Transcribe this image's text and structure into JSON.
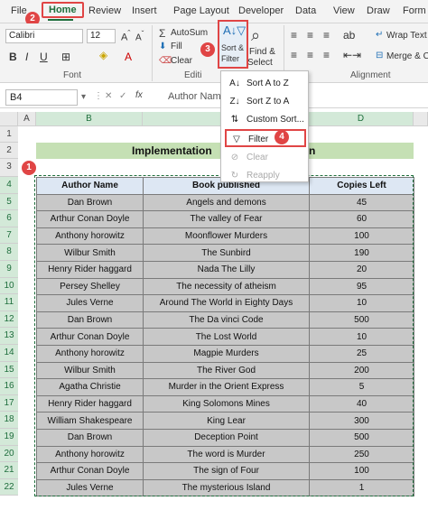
{
  "menu": {
    "tabs": [
      "File",
      "Home",
      "Review",
      "Insert",
      "Page Layout",
      "Developer",
      "Data",
      "View",
      "Draw",
      "Form"
    ]
  },
  "ribbon": {
    "font_name": "Calibri",
    "font_size": "12",
    "autosum_label": "AutoSum",
    "fill_label": "Fill",
    "clear_label": "Clear",
    "sort_filter_label_1": "Sort &",
    "sort_filter_label_2": "Filter",
    "find_select_label_1": "Find &",
    "find_select_label_2": "Select",
    "wrap_text_label": "Wrap Text",
    "merge_label": "Merge & C",
    "group_font": "Font",
    "group_editing": "Editi",
    "group_alignment": "Alignment"
  },
  "formula_bar": {
    "name_box": "B4",
    "content": "Author Nam"
  },
  "dropdown": {
    "items": [
      {
        "label": "Sort A to Z",
        "icon": "sort-az-icon",
        "enabled": true
      },
      {
        "label": "Sort Z to A",
        "icon": "sort-za-icon",
        "enabled": true
      },
      {
        "label": "Custom Sort...",
        "icon": "custom-sort-icon",
        "enabled": true
      },
      {
        "label": "Filter",
        "icon": "filter-icon",
        "enabled": true
      },
      {
        "label": "Clear",
        "icon": "clear-filter-icon",
        "enabled": false
      },
      {
        "label": "Reapply",
        "icon": "reapply-icon",
        "enabled": false
      }
    ]
  },
  "badges": [
    "1",
    "2",
    "3",
    "4"
  ],
  "grid": {
    "columns": [
      "A",
      "B",
      "C",
      "D"
    ],
    "rows": [
      "1",
      "2",
      "3",
      "4",
      "5",
      "6",
      "7",
      "8",
      "9",
      "10",
      "11",
      "12",
      "13",
      "14",
      "15",
      "16",
      "17",
      "18",
      "19",
      "20",
      "21",
      "22"
    ],
    "title": "Implementation",
    "title_suffix": "n",
    "headers": [
      "Author Name",
      "Book published",
      "Copies Left"
    ],
    "data": [
      [
        "Dan Brown",
        "Angels and demons",
        "45"
      ],
      [
        "Arthur Conan Doyle",
        "The valley of Fear",
        "60"
      ],
      [
        "Anthony horowitz",
        "Moonflower Murders",
        "100"
      ],
      [
        "Wilbur Smith",
        "The Sunbird",
        "190"
      ],
      [
        "Henry Rider haggard",
        "Nada The Lilly",
        "20"
      ],
      [
        "Persey Shelley",
        "The necessity of atheism",
        "95"
      ],
      [
        "Jules Verne",
        "Around The World in Eighty Days",
        "10"
      ],
      [
        "Dan Brown",
        "The Da vinci Code",
        "500"
      ],
      [
        "Arthur Conan Doyle",
        "The Lost World",
        "10"
      ],
      [
        "Anthony horowitz",
        "Magpie Murders",
        "25"
      ],
      [
        "Wilbur Smith",
        "The River God",
        "200"
      ],
      [
        "Agatha Christie",
        "Murder in the Orient Express",
        "5"
      ],
      [
        "Henry Rider haggard",
        "King Solomons Mines",
        "40"
      ],
      [
        "William Shakespeare",
        "King Lear",
        "300"
      ],
      [
        "Dan Brown",
        "Deception Point",
        "500"
      ],
      [
        "Anthony horowitz",
        "The word is Murder",
        "250"
      ],
      [
        "Arthur Conan Doyle",
        "The sign of Four",
        "100"
      ],
      [
        "Jules Verne",
        "The mysterious Island",
        "1"
      ]
    ]
  }
}
